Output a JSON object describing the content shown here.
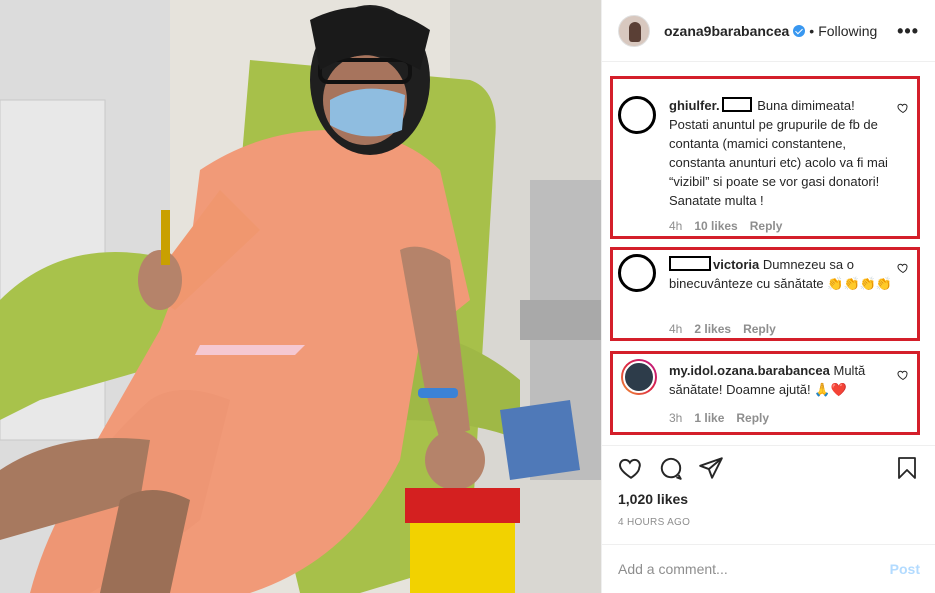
{
  "header": {
    "username": "ozana9barabancea",
    "separator": "•",
    "follow_status": "Following",
    "more_icon": "more-horizontal-icon",
    "verified_icon": "verified-badge-icon"
  },
  "comments": [
    {
      "username_visible": "ghiulfer.",
      "text": "Buna dimimeata! Postati anuntul pe grupurile de fb de contanta (mamici constantene, constanta anunturi etc) acolo va fi mai “vizibil” si poate se vor gasi donatori! Sanatate multa !",
      "time": "4h",
      "likes": "10 likes",
      "reply": "Reply"
    },
    {
      "username_visible": "victoria",
      "text": "Dumnezeu sa o binecuvânteze cu sănătate 👏👏👏👏",
      "time": "4h",
      "likes": "2 likes",
      "reply": "Reply"
    },
    {
      "username_visible": "my.idol.ozana.barabancea",
      "text": "Multă sănătate! Doamne ajută! 🙏❤️",
      "time": "3h",
      "likes": "1 like",
      "reply": "Reply"
    }
  ],
  "actions": {
    "like_icon": "heart-icon",
    "comment_icon": "comment-icon",
    "share_icon": "share-icon",
    "save_icon": "bookmark-icon"
  },
  "likes_count": "1,020 likes",
  "posted_ago": "4 HOURS AGO",
  "add_comment": {
    "placeholder": "Add a comment...",
    "post_label": "Post"
  },
  "colors": {
    "highlight_border": "#d41f2a",
    "post_button_disabled": "#b3dbff",
    "verified": "#3897f0"
  }
}
